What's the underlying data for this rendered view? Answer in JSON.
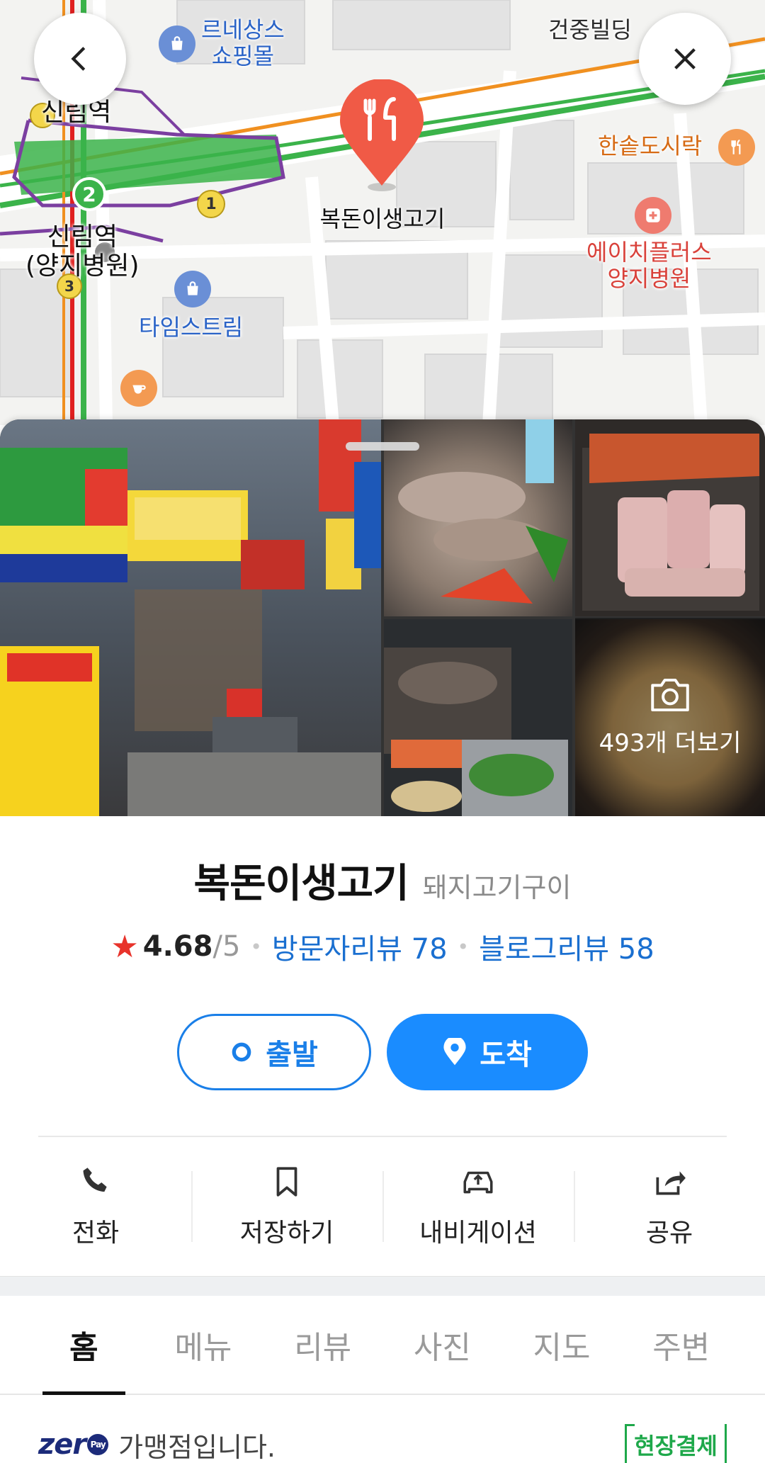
{
  "map": {
    "labels": {
      "renaissance": "르네상스\n쇼핑몰",
      "geonjung": "건중빌딩",
      "sillim_station": "신림역",
      "sillim_station_yangji": "신림역\n(양지병원)",
      "hansot": "한솥도시락",
      "h_plus": "에이치플러스\n양지병원",
      "timestream": "타임스트림",
      "pin_place": "복돈이생고기",
      "line2_badge": "2",
      "exit1_badge": "1",
      "exit3_badge": "3"
    },
    "icons": {
      "back": "chevron-left-icon",
      "close": "close-icon",
      "pin": "restaurant-pin-icon"
    },
    "colors": {
      "line2": "#3bb34a",
      "line_sillim": "#7b3fa0",
      "line_red": "#e02020",
      "line_orange": "#f09020",
      "pin": "#f05a46"
    }
  },
  "sheet": {
    "photos": {
      "more_label": "493개 더보기"
    },
    "place": {
      "name": "복돈이생고기",
      "category": "돼지고기구이",
      "rating_score": "4.68",
      "rating_scale": "/5",
      "visitor_reviews": "방문자리뷰 78",
      "blog_reviews": "블로그리뷰 58"
    },
    "route": {
      "start_label": "출발",
      "arrive_label": "도착"
    },
    "actions": [
      {
        "label": "전화",
        "icon": "phone-icon"
      },
      {
        "label": "저장하기",
        "icon": "bookmark-icon"
      },
      {
        "label": "내비게이션",
        "icon": "navigation-car-icon"
      },
      {
        "label": "공유",
        "icon": "share-icon"
      }
    ],
    "tabs": [
      {
        "label": "홈",
        "active": true
      },
      {
        "label": "메뉴",
        "active": false
      },
      {
        "label": "리뷰",
        "active": false
      },
      {
        "label": "사진",
        "active": false
      },
      {
        "label": "지도",
        "active": false
      },
      {
        "label": "주변",
        "active": false
      }
    ],
    "zero": {
      "logo": "zer",
      "logo_pay": "Pay",
      "text": "가맹점입니다.",
      "badge": "현장결제"
    }
  },
  "colors": {
    "accent": "#1a8cff",
    "link": "#1a6fd0",
    "star": "#e8332b",
    "onsite": "#1ea84a",
    "zero_brand": "#1c2b7a"
  }
}
